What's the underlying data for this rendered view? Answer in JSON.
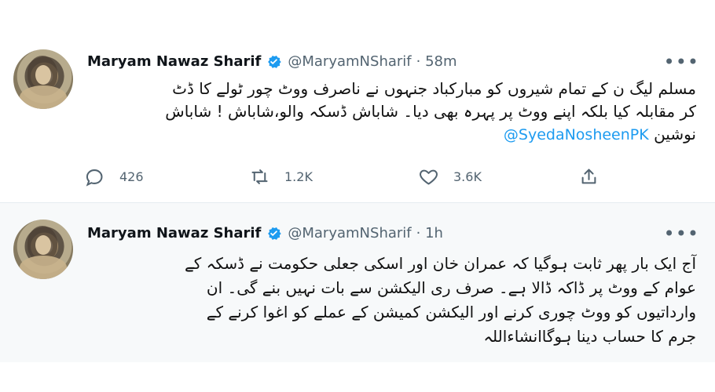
{
  "tweets": [
    {
      "name": "Maryam Nawaz Sharif",
      "handle": "@MaryamNSharif",
      "time": "· 58m",
      "lines": [
        "مسلم لیگ ن کے تمام شیروں کو مبارکباد جنہوں نے ناصرف ووٹ چور ٹولے کا ڈٹ",
        "کر مقابلہ کیا بلکہ اپنے ووٹ پر پہرہ بھی دیا۔ شاباش ڈسکہ والو،شاباش ! شاباش"
      ],
      "last_line_text": "نوشین",
      "mention": "@SyedaNosheenPK",
      "actions": {
        "replies": "426",
        "retweets": "1.2K",
        "likes": "3.6K"
      }
    },
    {
      "name": "Maryam Nawaz Sharif",
      "handle": "@MaryamNSharif",
      "time": "· 1h",
      "lines": [
        "آج ایک بار پھر ثابت ہوگیا کہ عمران خان اور اسکی جعلی حکومت نے ڈسکہ کے",
        "عوام کے ووٹ پر ڈاکہ ڈالا ہے۔ صرف ری الیکشن سے بات نہیں بنے گی۔ ان",
        "وارداتیوں کو ووٹ چوری کرنے اور الیکشن کمیشن کے عملے کو اغوا کرنے کے",
        "جرم کا حساب دینا ہوگاانشاءاللہ"
      ]
    }
  ],
  "icons": {
    "verified": "verified-badge-icon",
    "more": "more-icon",
    "reply": "reply-icon",
    "retweet": "retweet-icon",
    "like": "heart-icon",
    "share": "share-icon"
  },
  "colors": {
    "accent": "#1d9bf0",
    "text": "#0f1419",
    "secondary": "#536471",
    "divider": "#e6ecf0"
  }
}
